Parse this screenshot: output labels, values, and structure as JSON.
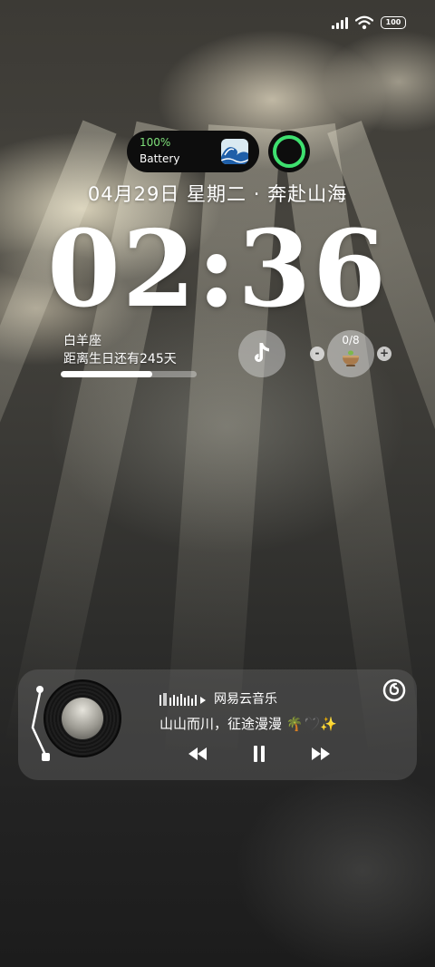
{
  "status": {
    "battery_level": "100"
  },
  "battery_widget": {
    "percent": "100%",
    "label": "Battery"
  },
  "date_line": "04月29日 星期二 · 奔赴山海",
  "clock": "02:36",
  "birthday_widget": {
    "sign": "白羊座",
    "countdown": "距离生日还有245天",
    "progress_fraction": 0.67
  },
  "counter_widget": {
    "count": "0/8",
    "minus_label": "-",
    "plus_label": "+"
  },
  "music": {
    "source": "网易云音乐",
    "title": "山山而川，征途漫漫 🌴🖤✨"
  },
  "colors": {
    "battery_green": "#7fe07a",
    "ring_green": "#3ee06f"
  }
}
